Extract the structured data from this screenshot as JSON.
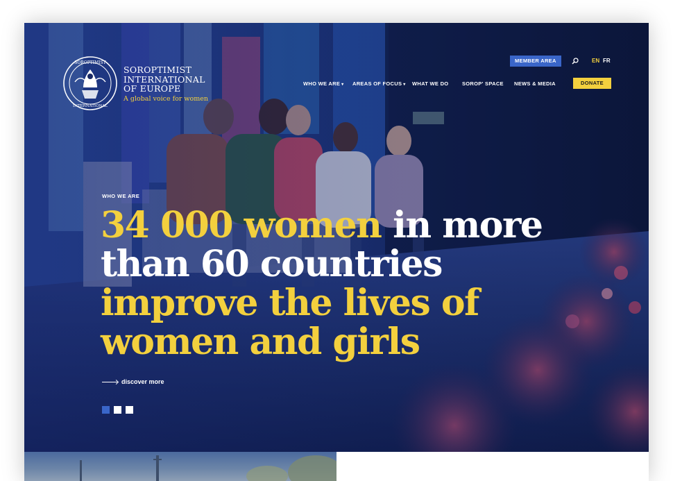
{
  "brand": {
    "name_lines": [
      "SOROPTIMIST",
      "INTERNATIONAL",
      "OF EUROPE"
    ],
    "tagline": "A global voice for women",
    "seal_text_top": "SOROPTIMIST",
    "seal_text_bottom": "INTERNATIONAL"
  },
  "utility": {
    "member_area": "MEMBER AREA",
    "search_icon": "search-icon",
    "languages": [
      {
        "code": "EN",
        "active": true
      },
      {
        "code": "FR",
        "active": false
      }
    ]
  },
  "nav": {
    "items": [
      {
        "label": "WHO WE ARE",
        "has_dropdown": true
      },
      {
        "label": "AREAS OF FOCUS",
        "has_dropdown": true
      },
      {
        "label": "WHAT WE DO",
        "has_dropdown": false
      },
      {
        "label": "SOROP' SPACE",
        "has_dropdown": false
      },
      {
        "label": "NEWS & MEDIA",
        "has_dropdown": false
      }
    ],
    "donate": "DONATE"
  },
  "hero": {
    "eyebrow": "WHO WE ARE",
    "headline": {
      "line1_yellow": "34 000 women",
      "line1_white": " in more",
      "line2_white": "than 60 countries",
      "line3_yellow": "improve the lives of",
      "line4_yellow": "women and girls"
    },
    "cta": "discover more",
    "slides": {
      "count": 3,
      "active": 1
    }
  },
  "colors": {
    "accent_yellow": "#f3d03e",
    "accent_blue": "#3a66c9",
    "hero_navy": "#1a2a66"
  }
}
